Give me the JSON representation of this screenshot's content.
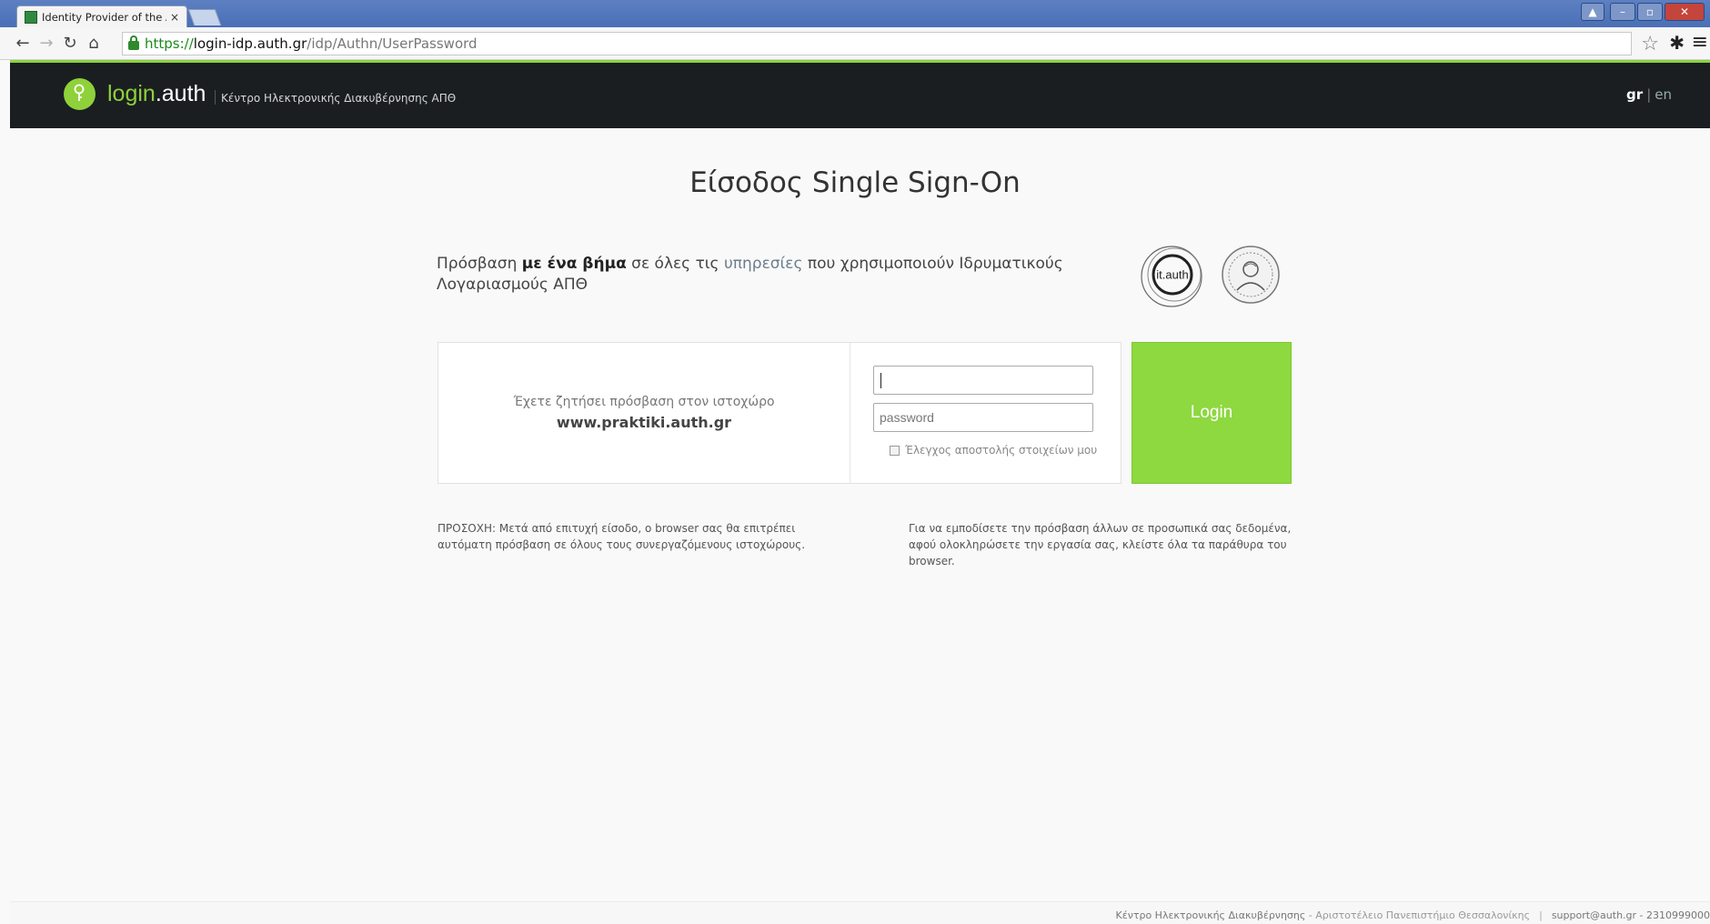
{
  "browser": {
    "tab_title": "Identity Provider of the Ar",
    "tab_close": "×",
    "url_scheme": "https://",
    "url_host": "login-idp.auth.gr",
    "url_path": "/idp/Authn/UserPassword",
    "icons": [
      "back-icon",
      "forward-icon",
      "reload-icon",
      "home-icon",
      "lock-icon",
      "star-icon",
      "gear-icon",
      "menu-icon"
    ]
  },
  "header": {
    "brand_login": "login",
    "brand_auth": ".auth",
    "subtitle": "Κέντρο Ηλεκτρονικής Διακυβέρνησης ΑΠΘ",
    "lang_gr": "gr",
    "lang_sep": "|",
    "lang_en": "en",
    "accent_color": "#8fd13a"
  },
  "main": {
    "title": "Είσοδος Single Sign-On",
    "intro_part1": "Πρόσβαση ",
    "intro_bold": "με ένα βήμα",
    "intro_part2": " σε όλες τις ",
    "intro_link": "υπηρεσίες",
    "intro_part3": " που χρησιμοποιούν Ιδρυματικούς Λογαριασμούς ΑΠΘ",
    "seal_it_text": "it.auth",
    "requested_text": "Έχετε ζητήσει πρόσβαση στον ιστοχώρο",
    "requested_site": "www.praktiki.auth.gr",
    "username_value": "",
    "password_placeholder": "password",
    "check_label": "Έλεγχος αποστολής στοιχείων μου",
    "login_label": "Login",
    "note_left": "ΠΡΟΣΟΧΗ: Μετά από επιτυχή είσοδο, ο browser σας θα επιτρέπει αυτόματη πρόσβαση σε όλους τους συνεργαζόμενους ιστοχώρους.",
    "note_right": "Για να εμποδίσετε την πρόσβαση άλλων σε προσωπικά σας δεδομένα, αφού ολοκληρώσετε την εργασία σας, κλείστε όλα τα παράθυρα του browser."
  },
  "footer": {
    "org": "Κέντρο Ηλεκτρονικής Διακυβέρνησης",
    "university": " - Αριστοτέλειο Πανεπιστήμιο Θεσσαλονίκης",
    "pipe": "|",
    "contact": "support@auth.gr - 2310999000"
  }
}
